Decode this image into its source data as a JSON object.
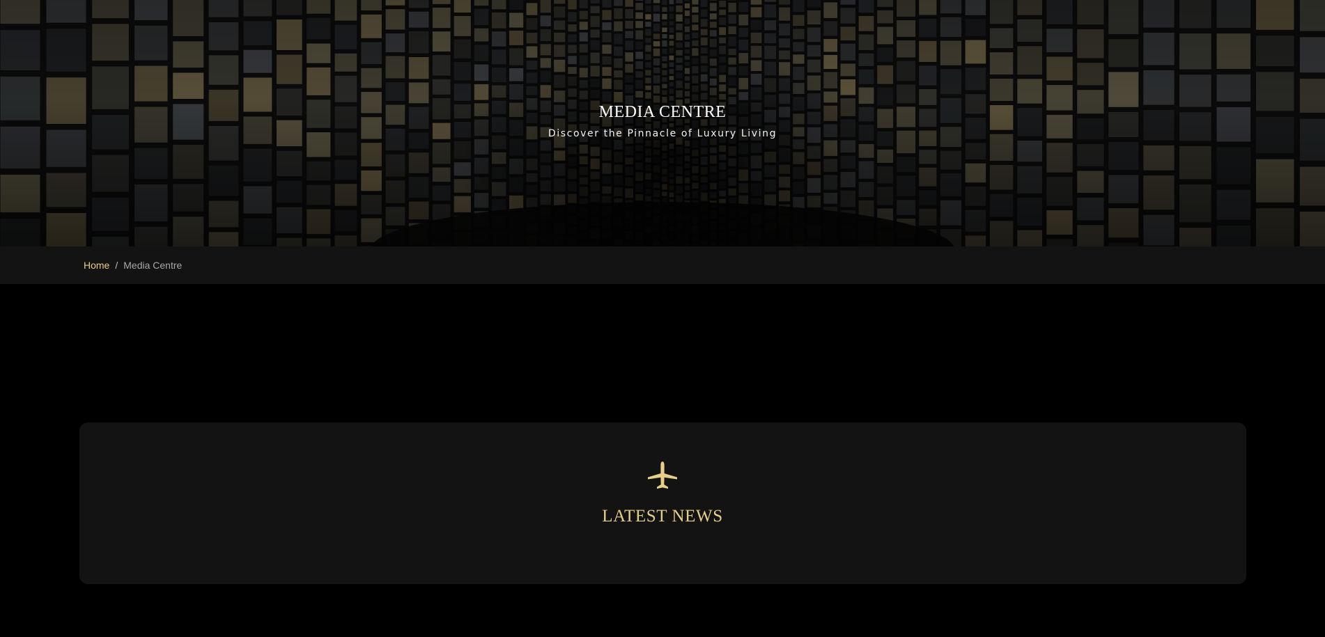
{
  "hero": {
    "title": "MEDIA CENTRE",
    "subtitle": "Discover the Pinnacle of Luxury Living"
  },
  "breadcrumb": {
    "home_label": "Home",
    "separator": "/",
    "current_label": "Media Centre"
  },
  "news_section": {
    "icon": "airplane-icon",
    "title": "LATEST NEWS"
  },
  "colors": {
    "accent_gold": "#e7cf8a",
    "background": "#000000",
    "panel": "#131313"
  }
}
